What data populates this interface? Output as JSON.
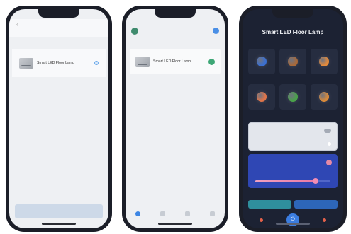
{
  "phone1": {
    "device": {
      "name": "Smart LED Floor Lamp"
    }
  },
  "phone2": {
    "device": {
      "name": "Smart LED Floor Lamp"
    }
  },
  "phone3": {
    "title": "Smart LED Floor Lamp",
    "scenes": [
      {
        "icon": "scene-blue-icon",
        "color": "#3b6fd0"
      },
      {
        "icon": "scene-brown-icon",
        "color": "#a8693a"
      },
      {
        "icon": "scene-orange-icon",
        "color": "#e28a3c"
      },
      {
        "icon": "scene-coral-icon",
        "color": "#e0754a"
      },
      {
        "icon": "scene-green-icon",
        "color": "#4aa24a"
      },
      {
        "icon": "scene-amber-icon",
        "color": "#d98a3a"
      }
    ],
    "brightness": 0.8,
    "colors": {
      "background": "#1c2233",
      "card_blue": "#2f47b4",
      "accent_pink": "#e979a5",
      "button_teal": "#2f8f9d",
      "button_blue": "#2d66b8",
      "power": "#3b7de0"
    }
  }
}
